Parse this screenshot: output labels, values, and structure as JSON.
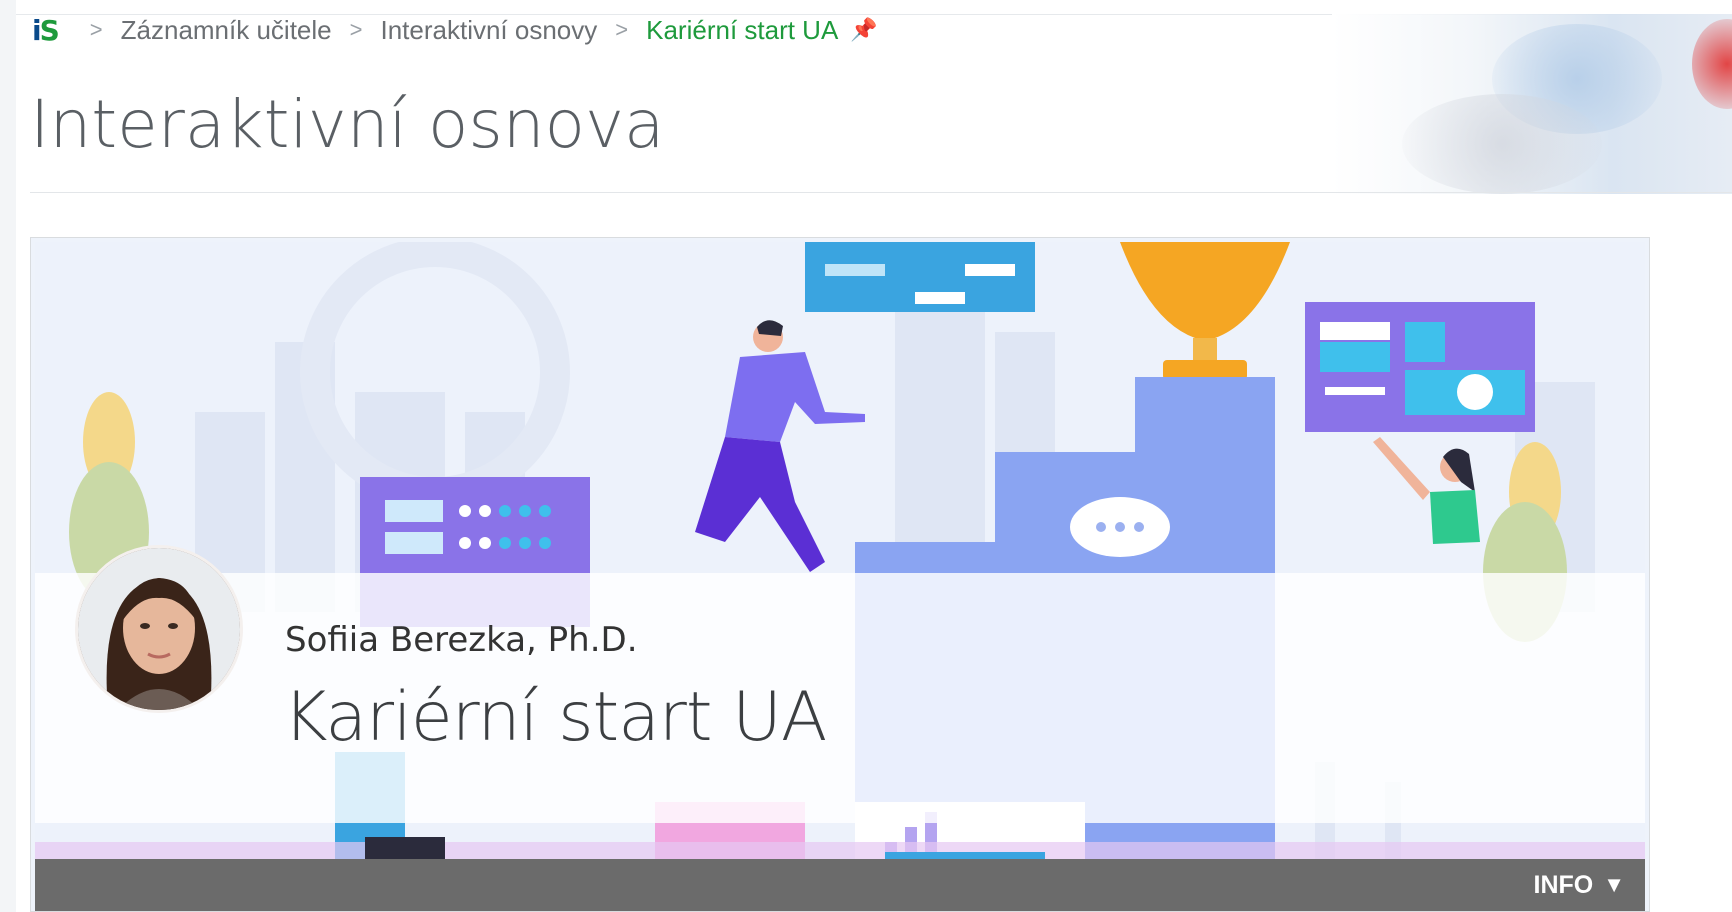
{
  "breadcrumb": {
    "logo": "IS",
    "items": [
      "Záznamník učitele",
      "Interaktivní osnovy",
      "Kariérní start UA"
    ]
  },
  "page": {
    "title": "Interaktivní osnova"
  },
  "course": {
    "author": "Sofiia Berezka, Ph.D.",
    "title": "Kariérní start UA",
    "info_button": "INFO"
  },
  "icons": {
    "pin": "pin-icon",
    "chevron_separator": "chevron-right-icon",
    "caret": "caret-down-icon"
  },
  "colors": {
    "brand_green": "#1e9a3c",
    "brand_blue": "#0a4a8a",
    "info_bar": "#6b6b6b"
  }
}
